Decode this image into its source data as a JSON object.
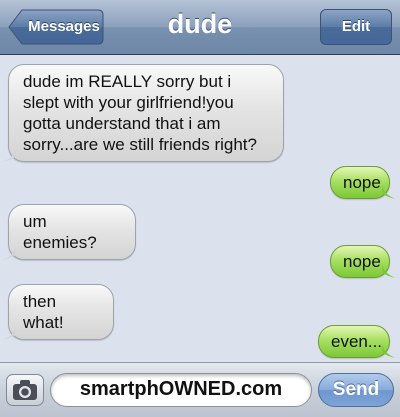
{
  "header": {
    "back_label": "Messages",
    "title": "dude",
    "edit_label": "Edit"
  },
  "messages": [
    {
      "direction": "incoming",
      "text": "dude im REALLY sorry but i slept with your girlfriend!you gotta understand that i am sorry...are we still friends right?"
    },
    {
      "direction": "outgoing",
      "text": "nope"
    },
    {
      "direction": "incoming",
      "text": "um enemies?"
    },
    {
      "direction": "outgoing",
      "text": "nope"
    },
    {
      "direction": "incoming",
      "text": "then what!"
    },
    {
      "direction": "outgoing",
      "text": "even..."
    }
  ],
  "input": {
    "value": "smartphOWNED.com",
    "send_label": "Send",
    "camera_icon": "camera-icon"
  },
  "colors": {
    "incoming_bubble": "#e4e4e4",
    "outgoing_bubble": "#a8e063",
    "navbar": "#7a91b0",
    "background": "#dbe2ed"
  }
}
